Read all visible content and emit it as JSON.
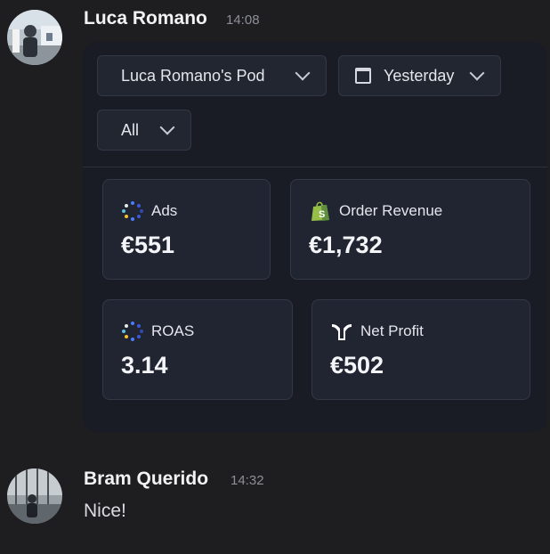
{
  "messages": [
    {
      "author": "Luca Romano",
      "time": "14:08",
      "embed": {
        "filters": {
          "pod": "Luca Romano's Pod",
          "date": "Yesterday",
          "channel": "All"
        },
        "metrics": [
          {
            "title": "Ads",
            "value": "€551",
            "icon": "ads-dots-icon"
          },
          {
            "title": "Order Revenue",
            "value": "€1,732",
            "icon": "shopify-bag-icon"
          },
          {
            "title": "ROAS",
            "value": "3.14",
            "icon": "roas-dots-icon"
          },
          {
            "title": "Net Profit",
            "value": "€502",
            "icon": "triple-whale-icon"
          }
        ]
      }
    },
    {
      "author": "Bram Querido",
      "time": "14:32",
      "text": "Nice!"
    }
  ],
  "colors": {
    "background": "#1e1e21",
    "embed_background": "#191c25",
    "card_background": "#212531",
    "shopify_green": "#95bf47"
  }
}
